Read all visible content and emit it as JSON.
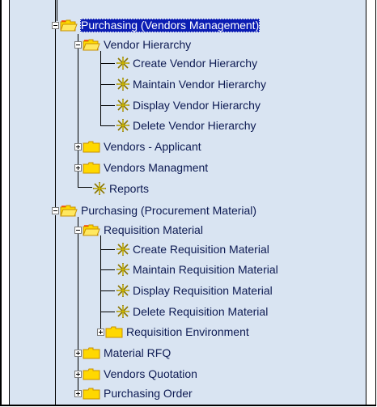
{
  "tree": {
    "purchasing_vendors": {
      "label": "Purchasing (Vendors Management)",
      "vendor_hierarchy": {
        "label": "Vendor Hierarchy",
        "items": [
          {
            "label": "Create Vendor Hierarchy"
          },
          {
            "label": "Maintain Vendor Hierarchy"
          },
          {
            "label": "Display Vendor Hierarchy"
          },
          {
            "label": "Delete Vendor Hierarchy"
          }
        ]
      },
      "vendors_applicant": {
        "label": "Vendors - Applicant"
      },
      "vendors_managment": {
        "label": "Vendors Managment"
      },
      "reports": {
        "label": "Reports"
      }
    },
    "purchasing_procurement": {
      "label": "Purchasing (Procurement Material)",
      "requisition_material": {
        "label": "Requisition Material",
        "items": [
          {
            "label": "Create Requisition Material"
          },
          {
            "label": "Maintain Requisition Material"
          },
          {
            "label": "Display Requisition Material"
          },
          {
            "label": "Delete Requisition Material"
          }
        ],
        "requisition_environment": {
          "label": "Requisition Environment"
        }
      },
      "material_rfq": {
        "label": "Material RFQ"
      },
      "vendors_quotation": {
        "label": "Vendors Quotation"
      },
      "purchasing_order": {
        "label": "Purchasing Order"
      }
    }
  },
  "colors": {
    "panel_background": "#d9e4f2",
    "selection_background": "#0b1db3",
    "text": "#0d1a52",
    "folder": "#ffd800",
    "star": "#e8d000"
  },
  "icons": {
    "folder_open": "folder-open-icon",
    "folder_closed": "folder-closed-icon",
    "transaction": "star-icon"
  }
}
